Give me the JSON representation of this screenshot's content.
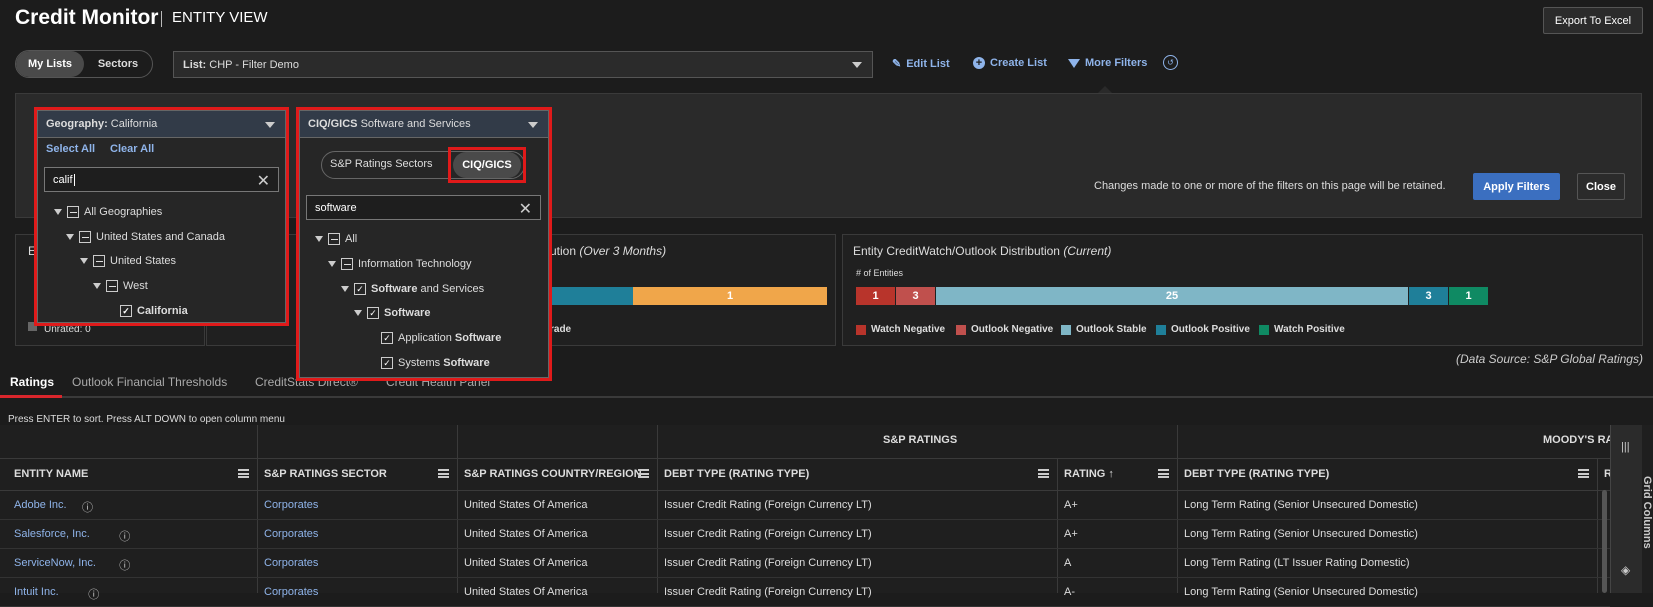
{
  "header": {
    "title": "Credit Monitor",
    "subtitle": "ENTITY VIEW",
    "export_label": "Export To Excel"
  },
  "toggle": {
    "my_lists": "My Lists",
    "sectors": "Sectors"
  },
  "list_select": {
    "prefix": "List:",
    "value": "CHP - Filter Demo"
  },
  "actions": {
    "edit_list": "Edit List",
    "create_list": "Create List",
    "more_filters": "More Filters"
  },
  "filters": {
    "retained_note": "Changes made to one or more of the filters on this page will be retained.",
    "apply_label": "Apply Filters",
    "close_label": "Close",
    "geography": {
      "prefix": "Geography:",
      "value": "California",
      "select_all": "Select All",
      "clear_all": "Clear All",
      "search": "calif",
      "tree": [
        "All Geographies",
        "United States and Canada",
        "United States",
        "West",
        "California"
      ]
    },
    "ciq": {
      "prefix": "CIQ/GICS",
      "value": "Software and Services",
      "seg_sp": "S&P Ratings Sectors",
      "seg_ciq": "CIQ/GICS",
      "search": "software",
      "tree": {
        "all": "All",
        "info_tech": "Information Technology",
        "sws_bold": "Software",
        "sws_rest": " and Services",
        "software": "Software",
        "app_pre": "Application ",
        "app_bold": "Software",
        "sys_pre": "Systems ",
        "sys_bold": "Software"
      }
    }
  },
  "stats": {
    "left_label_partial": "E",
    "unrated": "Unrated: 0",
    "grade_partial": "rade",
    "mid_title_partial": "ution",
    "mid_title_italic": "(Over 3 Months)",
    "mid_bar_value": "1",
    "cw_title": "Entity CreditWatch/Outlook Distribution",
    "cw_title_italic": "(Current)",
    "cw_axis": "# of Entities",
    "cw_bars": [
      {
        "label": "1",
        "value": 1,
        "color": "#b8342b"
      },
      {
        "label": "3",
        "value": 3,
        "color": "#c0504d"
      },
      {
        "label": "25",
        "value": 25,
        "color": "#7fb6c6"
      },
      {
        "label": "3",
        "value": 3,
        "color": "#1f7f99"
      },
      {
        "label": "1",
        "value": 1,
        "color": "#0f8a63"
      }
    ],
    "cw_legend": [
      "Watch Negative",
      "Outlook Negative",
      "Outlook Stable",
      "Outlook Positive",
      "Watch Positive"
    ],
    "data_source": "(Data Source: S&P Global Ratings)"
  },
  "tabs": [
    "Ratings",
    "Outlook Financial Thresholds",
    "CreditStats Direct®",
    "Credit Health Panel"
  ],
  "grid": {
    "hint": "Press ENTER to sort. Press ALT DOWN to open column menu",
    "group_sp": "S&P RATINGS",
    "group_moodys": "MOODY'S RAT",
    "columns": [
      "ENTITY NAME",
      "S&P RATINGS SECTOR",
      "S&P RATINGS COUNTRY/REGION",
      "DEBT TYPE (RATING TYPE)",
      "RATING ↑",
      "DEBT TYPE (RATING TYPE)",
      "R"
    ],
    "side_label": "Grid Columns",
    "rows": [
      [
        "Adobe Inc.",
        "Corporates",
        "United States Of America",
        "Issuer Credit Rating (Foreign Currency LT)",
        "A+",
        "Long Term Rating (Senior Unsecured Domestic)"
      ],
      [
        "Salesforce, Inc.",
        "Corporates",
        "United States Of America",
        "Issuer Credit Rating (Foreign Currency LT)",
        "A+",
        "Long Term Rating (Senior Unsecured Domestic)"
      ],
      [
        "ServiceNow, Inc.",
        "Corporates",
        "United States Of America",
        "Issuer Credit Rating (Foreign Currency LT)",
        "A",
        "Long Term Rating (LT Issuer Rating Domestic)"
      ],
      [
        "Intuit Inc.",
        "Corporates",
        "United States Of America",
        "Issuer Credit Rating (Foreign Currency LT)",
        "A-",
        "Long Term Rating (Senior Unsecured Domestic)"
      ]
    ]
  }
}
